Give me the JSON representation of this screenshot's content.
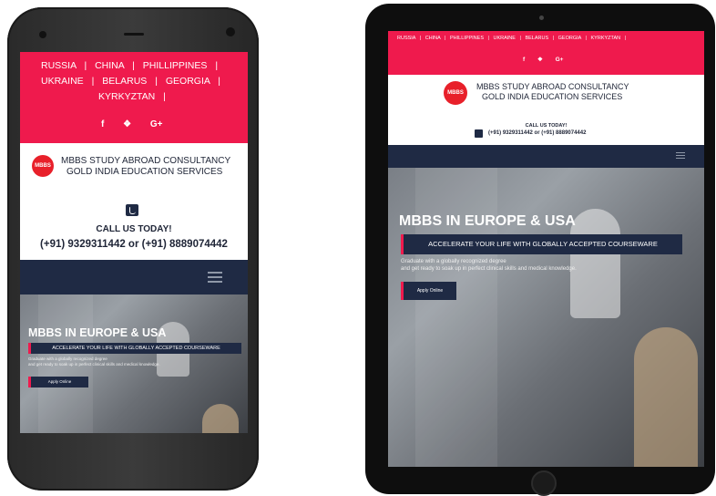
{
  "nav_links": [
    "RUSSIA",
    "CHINA",
    "PHILLIPPINES",
    "UKRAINE",
    "BELARUS",
    "GEORGIA",
    "KYRKYZTAN"
  ],
  "separator": "|",
  "social": {
    "facebook": "f",
    "twitter": "❖",
    "google": "G+"
  },
  "logo": {
    "badge": "MBBS",
    "line1": "MBBS STUDY ABROAD CONSULTANCY",
    "line2": "GOLD INDIA EDUCATION SERVICES"
  },
  "contact": {
    "call_label_phone": "CALL US TODAY!",
    "call_label_tablet": "CALL US TODAY!",
    "phones": "(+91) 9329311442 or (+91) 8889074442"
  },
  "hero": {
    "title": "MBBS IN EUROPE & USA",
    "banner": "ACCELERATE YOUR LIFE WITH GLOBALLY ACCEPTED COURSEWARE",
    "desc_line1": "Graduate with a globally recognized degree",
    "desc_line2": "and get ready to soak up in perfect clinical skills and medical knowledge.",
    "button": "Apply Online"
  },
  "colors": {
    "brand_pink": "#ef1a4d",
    "navy": "#1f2a44"
  },
  "icons": {
    "menu": "hamburger-menu-icon",
    "phone": "phone-icon"
  }
}
